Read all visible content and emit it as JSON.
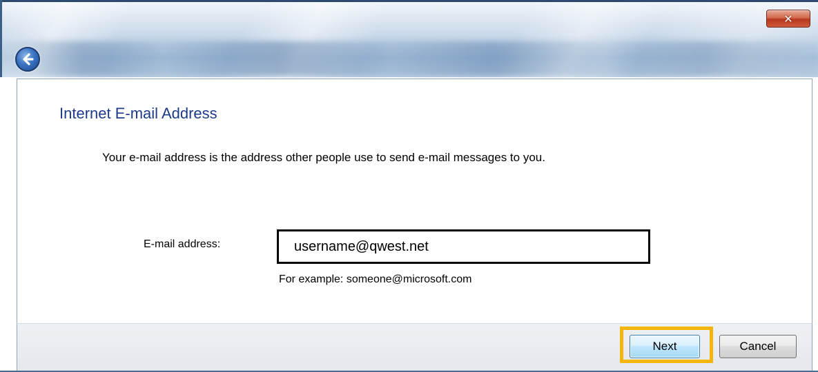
{
  "window": {
    "close_label": "✕"
  },
  "main": {
    "title": "Internet E-mail Address",
    "description": "Your e-mail address is the address other people use to send e-mail messages to you.",
    "email_label": "E-mail address:",
    "email_value": "username@qwest.net",
    "example_text": "For example: someone@microsoft.com"
  },
  "footer": {
    "next_label": "Next",
    "cancel_label": "Cancel"
  },
  "colors": {
    "title_blue": "#1e3a8a",
    "highlight": "#f5b50a"
  },
  "icons": {
    "back": "back-arrow-icon",
    "close": "close-icon"
  }
}
